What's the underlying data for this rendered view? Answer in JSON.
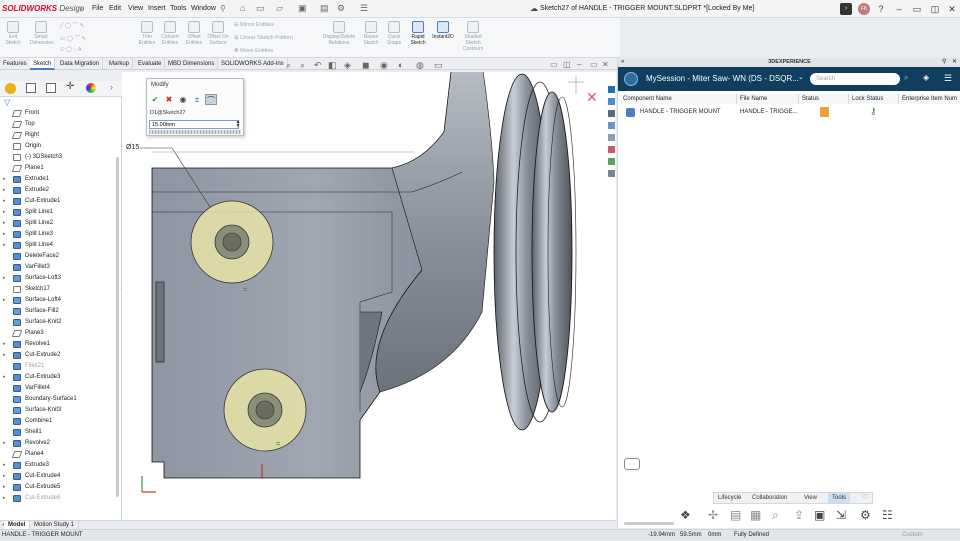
{
  "app": {
    "brand": "SOLIDWORKS",
    "edition": "Design",
    "document_title": "Sketch27 of HANDLE - TRIGGER MOUNT.SLDPRT *[Locked By Me]"
  },
  "menu": [
    "File",
    "Edit",
    "View",
    "Insert",
    "Tools",
    "Window"
  ],
  "ribbon": {
    "buttons": [
      {
        "label": "Exit Sketch",
        "active": false
      },
      {
        "label": "Smart Dimension",
        "active": false
      },
      {
        "label": "Trim Entities",
        "active": false
      },
      {
        "label": "Convert Entities",
        "active": false
      },
      {
        "label": "Offset Entities",
        "active": false
      },
      {
        "label": "Offset On Surface",
        "active": false
      },
      {
        "label": "Display/Delete Relations",
        "active": false
      },
      {
        "label": "Repair Sketch",
        "active": false
      },
      {
        "label": "Quick Snaps",
        "active": false
      },
      {
        "label": "Rapid Sketch",
        "active": true
      },
      {
        "label": "Instant2D",
        "active": true
      },
      {
        "label": "Shaded Sketch Contours",
        "active": false
      }
    ],
    "small": [
      "Mirror Entities",
      "Linear Sketch Pattern",
      "Move Entities"
    ]
  },
  "command_tabs": [
    {
      "label": "Features",
      "selected": false
    },
    {
      "label": "Sketch",
      "selected": true
    },
    {
      "label": "Data Migration",
      "selected": false
    },
    {
      "label": "Markup",
      "selected": false
    },
    {
      "label": "Evaluate",
      "selected": false
    },
    {
      "label": "MBD Dimensions",
      "selected": false
    },
    {
      "label": "SOLIDWORKS Add-Ins",
      "selected": false
    }
  ],
  "tree": [
    {
      "label": "Front",
      "icon": "plane",
      "expand": false,
      "dim": false
    },
    {
      "label": "Top",
      "icon": "plane",
      "expand": false,
      "dim": false
    },
    {
      "label": "Right",
      "icon": "plane",
      "expand": false,
      "dim": false
    },
    {
      "label": "Origin",
      "icon": "origin",
      "expand": false,
      "dim": false
    },
    {
      "label": "(-) 3DSketch3",
      "icon": "sketch3d",
      "expand": false,
      "dim": false
    },
    {
      "label": "Plane1",
      "icon": "plane",
      "expand": false,
      "dim": false
    },
    {
      "label": "Extrude1",
      "icon": "feature",
      "expand": true,
      "dim": false
    },
    {
      "label": "Extrude2",
      "icon": "feature",
      "expand": true,
      "dim": false
    },
    {
      "label": "Cut-Extrude1",
      "icon": "feature",
      "expand": true,
      "dim": false
    },
    {
      "label": "Split Line1",
      "icon": "feature",
      "expand": true,
      "dim": false
    },
    {
      "label": "Split Line2",
      "icon": "feature",
      "expand": true,
      "dim": false
    },
    {
      "label": "Split Line3",
      "icon": "feature",
      "expand": true,
      "dim": false
    },
    {
      "label": "Split Line4",
      "icon": "feature",
      "expand": true,
      "dim": false
    },
    {
      "label": "DeleteFace2",
      "icon": "feature",
      "expand": false,
      "dim": false
    },
    {
      "label": "VarFillet3",
      "icon": "feature",
      "expand": false,
      "dim": false
    },
    {
      "label": "Surface-Loft3",
      "icon": "surface",
      "expand": true,
      "dim": false
    },
    {
      "label": "Sketch17",
      "icon": "sketch",
      "expand": false,
      "dim": false
    },
    {
      "label": "Surface-Loft4",
      "icon": "surface",
      "expand": true,
      "dim": false
    },
    {
      "label": "Surface-Fill2",
      "icon": "surface",
      "expand": false,
      "dim": false
    },
    {
      "label": "Surface-Knit2",
      "icon": "surface",
      "expand": false,
      "dim": false
    },
    {
      "label": "Plane3",
      "icon": "plane",
      "expand": false,
      "dim": false
    },
    {
      "label": "Revolve1",
      "icon": "feature",
      "expand": true,
      "dim": false
    },
    {
      "label": "Cut-Extrude2",
      "icon": "feature",
      "expand": true,
      "dim": false
    },
    {
      "label": "Fillet21",
      "icon": "feature",
      "expand": false,
      "dim": true
    },
    {
      "label": "Cut-Extrude3",
      "icon": "feature",
      "expand": true,
      "dim": false
    },
    {
      "label": "VarFillet4",
      "icon": "feature",
      "expand": false,
      "dim": false
    },
    {
      "label": "Boundary-Surface1",
      "icon": "surface",
      "expand": false,
      "dim": false
    },
    {
      "label": "Surface-Knit3",
      "icon": "surface",
      "expand": false,
      "dim": false
    },
    {
      "label": "Combine1",
      "icon": "feature",
      "expand": false,
      "dim": false
    },
    {
      "label": "Shell1",
      "icon": "feature",
      "expand": false,
      "dim": false
    },
    {
      "label": "Revolve2",
      "icon": "feature",
      "expand": true,
      "dim": false
    },
    {
      "label": "Plane4",
      "icon": "plane",
      "expand": false,
      "dim": false
    },
    {
      "label": "Extrude3",
      "icon": "feature",
      "expand": true,
      "dim": false
    },
    {
      "label": "Cut-Extrude4",
      "icon": "feature",
      "expand": true,
      "dim": false
    },
    {
      "label": "Cut-Extrude5",
      "icon": "feature",
      "expand": true,
      "dim": false
    },
    {
      "label": "Cut-Extrude6",
      "icon": "feature",
      "expand": true,
      "dim": true
    }
  ],
  "modify": {
    "title": "Modify",
    "dimension_name": "D1@Sketch27",
    "value": "15.00mm"
  },
  "dimension_label": "Ø15",
  "right_panel": {
    "title": "3DEXPERIENCE",
    "session": "MySession - Miter Saw- WN (DS - DSQR...",
    "search_placeholder": "Search",
    "columns": [
      "Component Name",
      "File Name",
      "Status",
      "Lock Status",
      "Enterprise Item Num"
    ],
    "rows": [
      {
        "component": "HANDLE - TRIGGER MOUNT",
        "file": "HANDLE - TRIGGE..."
      }
    ],
    "tabs": [
      {
        "label": "Lifecycle",
        "selected": false
      },
      {
        "label": "Collaboration",
        "selected": false
      },
      {
        "label": "View",
        "selected": false
      },
      {
        "label": "Tools",
        "selected": true
      }
    ]
  },
  "bottom_tabs": [
    {
      "label": "Model",
      "selected": true
    },
    {
      "label": "Motion Study 1",
      "selected": false
    }
  ],
  "status": {
    "doc": "HANDLE - TRIGGER MOUNT",
    "x": "-19.94mm",
    "y": "59.5mm",
    "z": "0mm",
    "state": "Fully Defined",
    "units": "Custom"
  },
  "colors": {
    "brand": "#c8102e",
    "accent": "#4a7fc0",
    "panel_header": "#0f3e5e"
  }
}
